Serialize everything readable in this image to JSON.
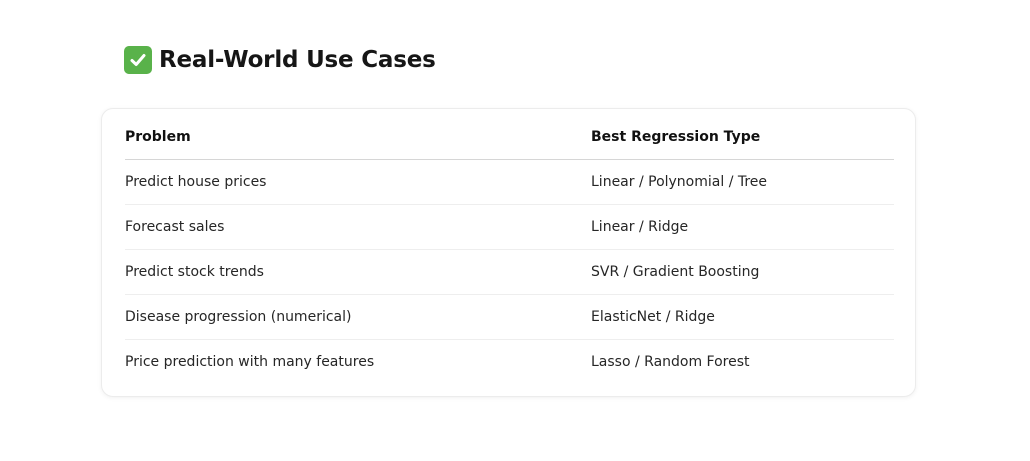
{
  "section": {
    "icon": "check-mark-button-icon",
    "title": "Real-World Use Cases",
    "icon_color": "#59b24a"
  },
  "table": {
    "headers": [
      "Problem",
      "Best Regression Type"
    ],
    "rows": [
      [
        "Predict house prices",
        "Linear / Polynomial / Tree"
      ],
      [
        "Forecast sales",
        "Linear / Ridge"
      ],
      [
        "Predict stock trends",
        "SVR / Gradient Boosting"
      ],
      [
        "Disease progression (numerical)",
        "ElasticNet / Ridge"
      ],
      [
        "Price prediction with many features",
        "Lasso / Random Forest"
      ]
    ]
  }
}
